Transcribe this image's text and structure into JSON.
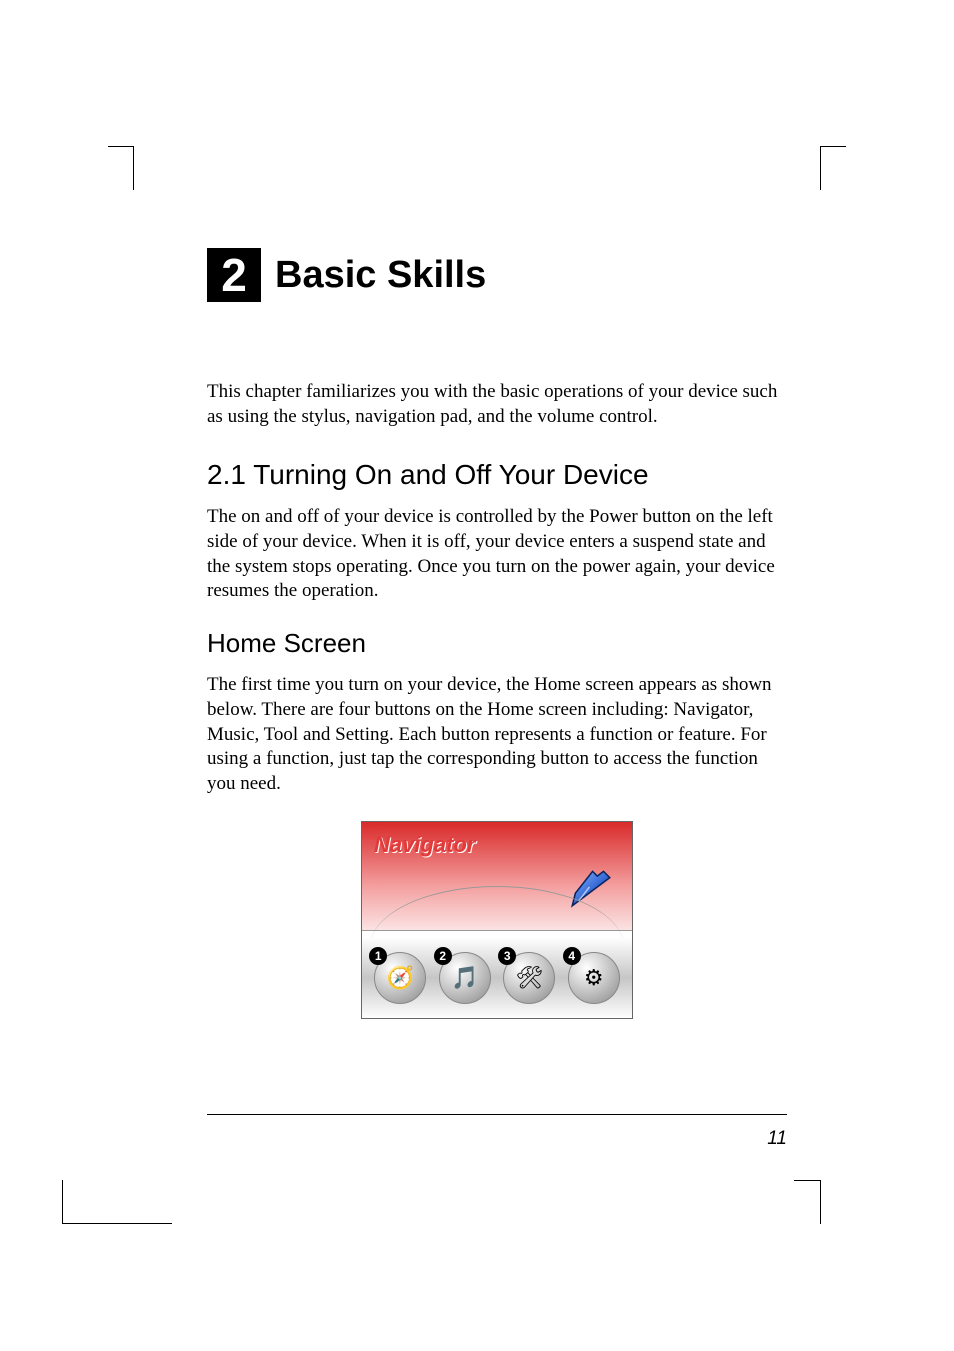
{
  "chapter": {
    "number": "2",
    "title": "Basic Skills",
    "intro": "This chapter familiarizes you with the basic operations of your device such as using the stylus, navigation pad, and the volume control."
  },
  "section": {
    "number": "2.1",
    "title": "Turning On and Off Your Device",
    "heading": "2.1   Turning On and Off Your Device",
    "body": "The on and off of your device is controlled by the Power button on the left side of your device. When it is off, your device enters a suspend state and the system stops operating. Once you turn on the power again, your device resumes the operation."
  },
  "subsection": {
    "title": "Home Screen",
    "body": "The first time you turn on your device, the Home screen appears as shown below. There are four buttons on the Home screen including: Navigator, Music, Tool and Setting. Each button represents a function or feature. For using a function, just tap the corresponding button to access the function you need."
  },
  "home_screen": {
    "label": "Navigator",
    "buttons": [
      {
        "badge": "1",
        "name": "Navigator",
        "glyph": "🧭"
      },
      {
        "badge": "2",
        "name": "Music",
        "glyph": "🎵"
      },
      {
        "badge": "3",
        "name": "Tool",
        "glyph": "🛠"
      },
      {
        "badge": "4",
        "name": "Setting",
        "glyph": "⚙"
      }
    ]
  },
  "page_number": "11"
}
